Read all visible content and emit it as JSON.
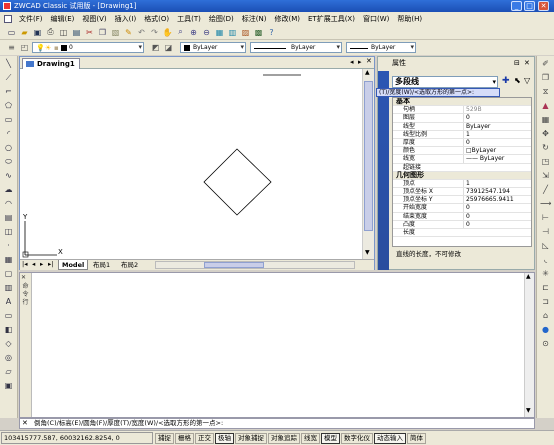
{
  "window": {
    "title": "ZWCAD Classic 试用版 - [Drawing1]"
  },
  "menu": [
    "文件(F)",
    "编辑(E)",
    "视图(V)",
    "插入(I)",
    "格式(O)",
    "工具(T)",
    "绘图(D)",
    "标注(N)",
    "修改(M)",
    "ET扩展工具(X)",
    "窗口(W)",
    "帮助(H)"
  ],
  "toolbar2": {
    "layer_value": "0",
    "color_value": "ByLayer",
    "linetype_value": "ByLayer",
    "lineweight_value": "ByLayer"
  },
  "drawing": {
    "tab": "Drawing1",
    "layout_tabs": [
      "Model",
      "布局1",
      "布局2"
    ],
    "axis_x": "X",
    "axis_y": "Y"
  },
  "properties": {
    "header": "属性",
    "object_type": "多段线",
    "tooltip": "(T)/宽度(W)/<选取方形的第一点>:",
    "rows": [
      {
        "name": "基本",
        "value": "",
        "section": true
      },
      {
        "name": "句柄",
        "value": "529B"
      },
      {
        "name": "图层",
        "value": "0"
      },
      {
        "name": "线型",
        "value": "ByLayer"
      },
      {
        "name": "线型比例",
        "value": "1"
      },
      {
        "name": "厚度",
        "value": "0"
      },
      {
        "name": "颜色",
        "value": "□ByLayer"
      },
      {
        "name": "线宽",
        "value": "—— ByLayer"
      },
      {
        "name": "超链接",
        "value": ""
      },
      {
        "name": "几何图形",
        "value": "",
        "section": true
      },
      {
        "name": "顶点",
        "value": "1"
      },
      {
        "name": "顶点坐标 X",
        "value": "73912547.194"
      },
      {
        "name": "顶点坐标 Y",
        "value": "25976665.9411"
      },
      {
        "name": "开始宽度",
        "value": "0"
      },
      {
        "name": "结束宽度",
        "value": "0"
      },
      {
        "name": "凸度",
        "value": "0"
      },
      {
        "name": "长度",
        "value": ""
      }
    ],
    "description": "直线的长度，不可修改"
  },
  "command": {
    "panel_label": "命令行",
    "prompt": "倒角(C)/标高(E)/圆角(F)/厚度(T)/宽度(W)/<选取方形的第一点>:"
  },
  "status": {
    "coords": "103415777.587, 60032162.8254, 0",
    "buttons": [
      {
        "label": "捕捉",
        "on": false
      },
      {
        "label": "栅格",
        "on": false
      },
      {
        "label": "正交",
        "on": false
      },
      {
        "label": "极轴",
        "on": true
      },
      {
        "label": "对象捕捉",
        "on": false
      },
      {
        "label": "对象追踪",
        "on": false
      },
      {
        "label": "线宽",
        "on": false
      },
      {
        "label": "模型",
        "on": true
      },
      {
        "label": "数字化仪",
        "on": false
      },
      {
        "label": "动态输入",
        "on": true
      },
      {
        "label": "简体",
        "on": false
      }
    ]
  }
}
